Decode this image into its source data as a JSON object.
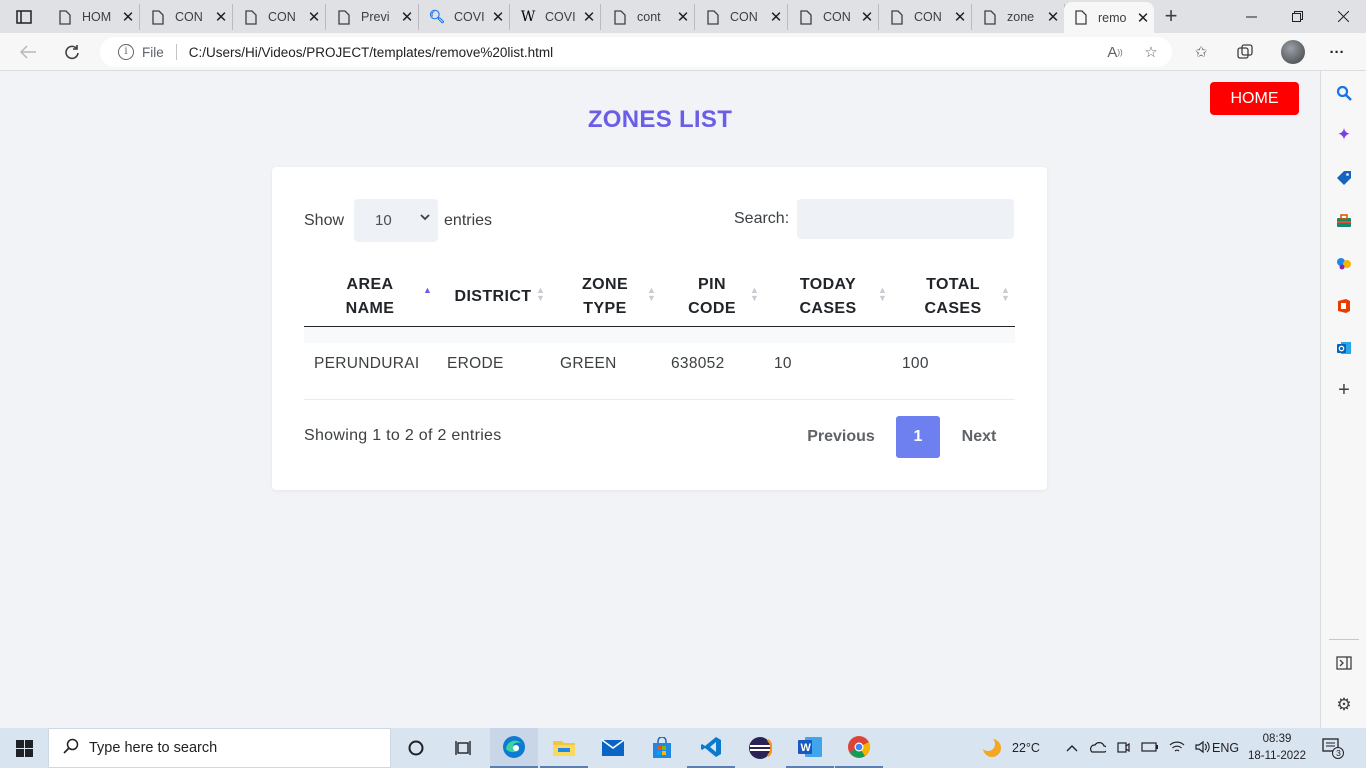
{
  "browser": {
    "tabs": [
      {
        "title": "HOM",
        "icon": "document-icon"
      },
      {
        "title": "CON",
        "icon": "document-icon"
      },
      {
        "title": "CON",
        "icon": "document-icon"
      },
      {
        "title": "Previ",
        "icon": "preview-icon"
      },
      {
        "title": "COVI",
        "icon": "search-icon"
      },
      {
        "title": "COVI",
        "icon": "wikipedia-icon"
      },
      {
        "title": "cont",
        "icon": "document-icon"
      },
      {
        "title": "CON",
        "icon": "document-icon"
      },
      {
        "title": "CON",
        "icon": "document-icon"
      },
      {
        "title": "CON",
        "icon": "document-icon"
      },
      {
        "title": "zone",
        "icon": "document-icon"
      },
      {
        "title": "remo",
        "icon": "document-icon",
        "active": true
      }
    ],
    "address": {
      "file_label": "File",
      "url": "C:/Users/Hi/Videos/PROJECT/templates/remove%20list.html"
    }
  },
  "page": {
    "home_label": "HOME",
    "title": "ZONES LIST",
    "length_label_before": "Show",
    "length_value": "10",
    "length_label_after": "entries",
    "search_label": "Search:",
    "search_value": "",
    "columns": [
      {
        "line1": "AREA",
        "line2": "NAME",
        "sort": "asc"
      },
      {
        "line1": "DISTRICT",
        "line2": "",
        "sort": "none"
      },
      {
        "line1": "ZONE",
        "line2": "TYPE",
        "sort": "none"
      },
      {
        "line1": "PIN",
        "line2": "CODE",
        "sort": "none"
      },
      {
        "line1": "TODAY",
        "line2": "CASES",
        "sort": "none"
      },
      {
        "line1": "TOTAL",
        "line2": "CASES",
        "sort": "none"
      }
    ],
    "rows": [
      {
        "area": "PERUNDURAI",
        "district": "ERODE",
        "zone_type": "GREEN",
        "pin": "638052",
        "today": "10",
        "total": "100"
      }
    ],
    "info": "Showing 1 to 2 of 2 entries",
    "pagination": {
      "previous": "Previous",
      "current": "1",
      "next": "Next"
    },
    "colors": {
      "title": "#6a5ee8",
      "home_button": "#ff0000",
      "page_active": "#6e7ff0"
    }
  },
  "taskbar": {
    "search_placeholder": "Type here to search",
    "weather": "22°C",
    "language": "ENG",
    "time": "08:39",
    "date": "18-11-2022",
    "notifications": "3"
  }
}
